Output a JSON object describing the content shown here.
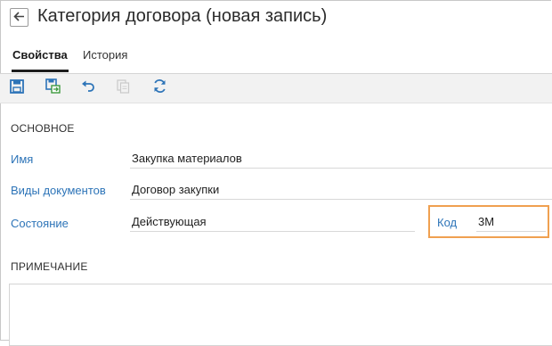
{
  "header": {
    "title": "Категория договора (новая запись)"
  },
  "tabs": [
    {
      "label": "Свойства",
      "active": true
    },
    {
      "label": "История",
      "active": false
    }
  ],
  "toolbar": {
    "buttons": [
      {
        "icon": "save-icon"
      },
      {
        "icon": "save-and-close-icon"
      },
      {
        "icon": "undo-icon"
      },
      {
        "icon": "copy-icon",
        "disabled": true
      },
      {
        "icon": "refresh-icon"
      }
    ]
  },
  "main": {
    "section_label": "ОСНОВНОЕ",
    "fields": {
      "name": {
        "label": "Имя",
        "value": "Закупка материалов"
      },
      "doc_types": {
        "label": "Виды документов",
        "value": "Договор закупки"
      },
      "state": {
        "label": "Состояние",
        "value": "Действующая"
      },
      "code": {
        "label": "Код",
        "value": "3М"
      }
    },
    "note_label": "ПРИМЕЧАНИЕ",
    "note_value": ""
  },
  "colors": {
    "accent": "#2d74b8",
    "highlight": "#f0a050",
    "toolbar_icon": "#2d74b8",
    "toolbar_icon_green": "#3e9a3e"
  }
}
